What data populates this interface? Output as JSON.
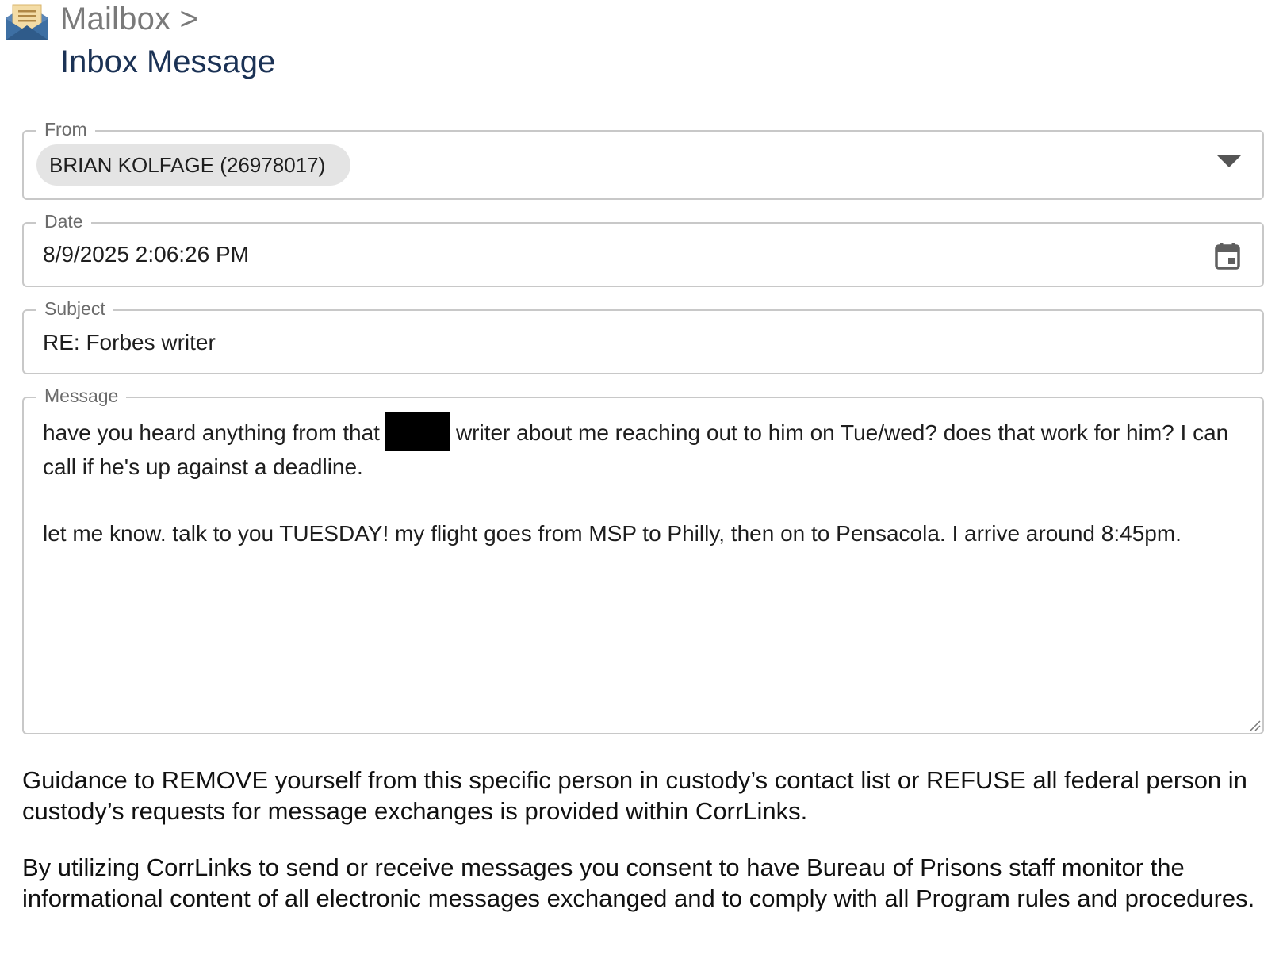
{
  "header": {
    "breadcrumb": "Mailbox >",
    "title": "Inbox Message",
    "icon": "open-envelope-icon"
  },
  "from": {
    "label": "From",
    "value": "BRIAN KOLFAGE (26978017)",
    "icon": "chevron-down-icon"
  },
  "date": {
    "label": "Date",
    "value": "8/9/2025 2:06:26 PM",
    "icon": "calendar-icon"
  },
  "subject": {
    "label": "Subject",
    "value": "RE: Forbes writer"
  },
  "message": {
    "label": "Message",
    "line1_before": "have you heard anything from that",
    "line1_after": "writer about me reaching out to him on Tue/wed? does that work for him? I can call if he's up against a deadline.",
    "line2": "let me know.  talk to you TUESDAY! my flight goes from MSP to Philly, then on to Pensacola. I arrive around 8:45pm."
  },
  "footer": {
    "guidance": "Guidance to REMOVE yourself from this specific person in custody’s contact list or REFUSE all federal person in custody’s requests for message exchanges is provided within CorrLinks.",
    "consent": "By utilizing CorrLinks to send or receive messages you consent to have Bureau of Prisons staff monitor the informational content of all electronic messages exchanged and to comply with all Program rules and procedures."
  },
  "colors": {
    "title": "#1b3255",
    "breadcrumb": "#7a7a7a",
    "field_border": "#c8c8c8",
    "chip_bg": "#e4e4e4",
    "envelope_blue": "#3d6fa3",
    "envelope_paper": "#e9c98a"
  }
}
